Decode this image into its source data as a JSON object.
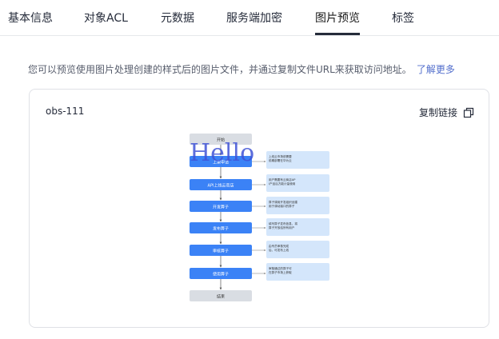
{
  "tabs": [
    {
      "label": "基本信息"
    },
    {
      "label": "对象ACL"
    },
    {
      "label": "元数据"
    },
    {
      "label": "服务端加密"
    },
    {
      "label": "图片预览"
    },
    {
      "label": "标签"
    }
  ],
  "active_tab": "图片预览",
  "description": {
    "text": "您可以预览使用图片处理创建的样式后的图片文件，并通过复制文件URL来获取访问地址。",
    "link": "了解更多"
  },
  "preview": {
    "object_name": "obs-111",
    "copy_label": "复制链接",
    "watermark": "Hello",
    "flow_steps": [
      "开始",
      "上架申请",
      "API上线云商店",
      "开发算子",
      "发布算子",
      "审核算子",
      "使用算子",
      "结束"
    ],
    "notes": [
      "上线云市场前需要前期部署在华为云",
      "用户需要有云商店API产品后方能计量使用",
      "算子调用开发组织创建用于调动接口的算子",
      "填写算子发布信息，将算子开放给所有用户",
      "由专员审核完成后，可发布上线",
      "审核通过的算子可在算子市场上获取"
    ],
    "colors": {
      "step": "#3b82f6",
      "terminal": "#d9dde3",
      "note": "#d4e6fb",
      "watermark": "#3f54d6"
    }
  },
  "colors": {
    "link": "#526ecc",
    "border": "#dfe1e6",
    "text": "#252b3a",
    "muted": "#575d6c"
  }
}
